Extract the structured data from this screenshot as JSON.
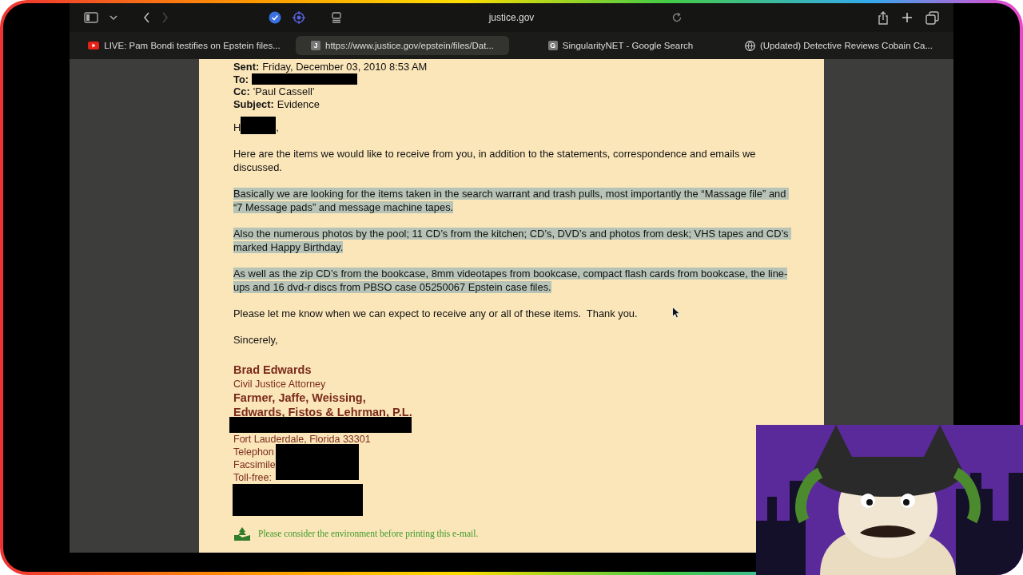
{
  "browser": {
    "address": "justice.gov",
    "tabs": [
      {
        "label": "LIVE: Pam Bondi testifies on Epstein files...",
        "kind": "video",
        "selected": false
      },
      {
        "label": "https://www.justice.gov/epstein/files/Dat...",
        "kind": "letter",
        "letter": "J",
        "selected": true
      },
      {
        "label": "SingularityNET - Google Search",
        "kind": "letter",
        "letter": "G",
        "selected": false
      },
      {
        "label": "(Updated) Detective Reviews Cobain Ca...",
        "kind": "globe",
        "selected": false
      }
    ]
  },
  "email": {
    "header": [
      {
        "label": "Sent:",
        "value": "Friday, December 03, 2010 8:53 AM",
        "redacted": false
      },
      {
        "label": "To:",
        "redacted": true
      },
      {
        "label": "Cc:",
        "value": "'Paul Cassell'",
        "redacted": false
      },
      {
        "label": "Subject:",
        "value": "Evidence",
        "redacted": false
      }
    ],
    "greeting": {
      "text": "H",
      "suffix": ","
    },
    "paragraphs": [
      {
        "text": "Here are the items we would like to receive from you, in addition to the statements, correspondence and emails we discussed.",
        "highlighted": false
      },
      {
        "text": "Basically we are looking for the items taken in the search warrant and trash pulls, most importantly the “Massage file” and “7 Message pads” and message machine tapes.",
        "highlighted": true
      },
      {
        "text": "Also the numerous photos by the pool; 11 CD’s from the kitchen; CD’s, DVD’s and photos from desk; VHS tapes and CD’s marked Happy Birthday.",
        "highlighted": true
      },
      {
        "text": "As well as the zip CD’s from the bookcase, 8mm videotapes from bookcase, compact flash cards from bookcase, the line-ups and 16 dvd-r discs from PBSO case 05250067 Epstein case files.",
        "highlighted": true
      },
      {
        "text": "Please let me know when we can expect to receive any or all of these items.  Thank you.",
        "highlighted": false
      }
    ],
    "closing": "Sincerely,",
    "signature": {
      "name": "Brad Edwards",
      "title": "Civil Justice Attorney",
      "firm": [
        "Farmer, Jaffe, Weissing,",
        "Edwards, Fistos & Lehrman, P.L."
      ],
      "address": "Fort Lauderdale, Florida 33301",
      "contacts": [
        "Telephon",
        "Facsimile",
        "Toll-free:"
      ]
    },
    "environment_note": "Please consider the environment before printing this e-mail."
  }
}
